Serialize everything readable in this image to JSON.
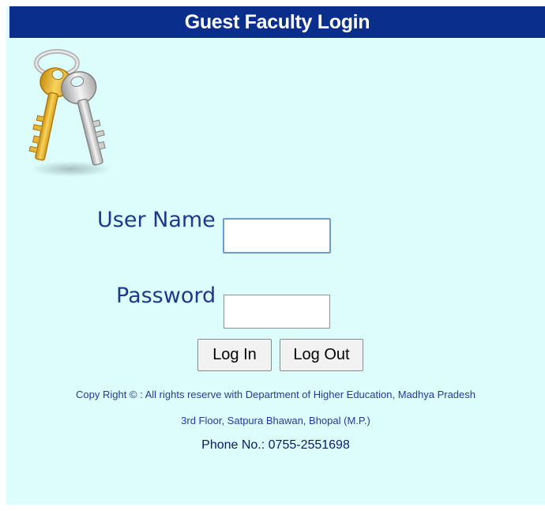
{
  "header": {
    "title": "Guest Faculty Login",
    "background_color": "#0a2e8c"
  },
  "panel": {
    "background_color": "#ddfdfd"
  },
  "illustration": {
    "icon": "keys-icon"
  },
  "form": {
    "username_label": "User Name",
    "username_value": "",
    "password_label": "Password",
    "password_value": "",
    "login_label": "Log In",
    "logout_label": "Log Out"
  },
  "footer": {
    "copyright": "Copy Right © : All rights reserve with Department of Higher Education, Madhya Pradesh",
    "address": "3rd Floor, Satpura Bhawan, Bhopal (M.P.)",
    "phone": "Phone No.: 0755-2551698"
  }
}
